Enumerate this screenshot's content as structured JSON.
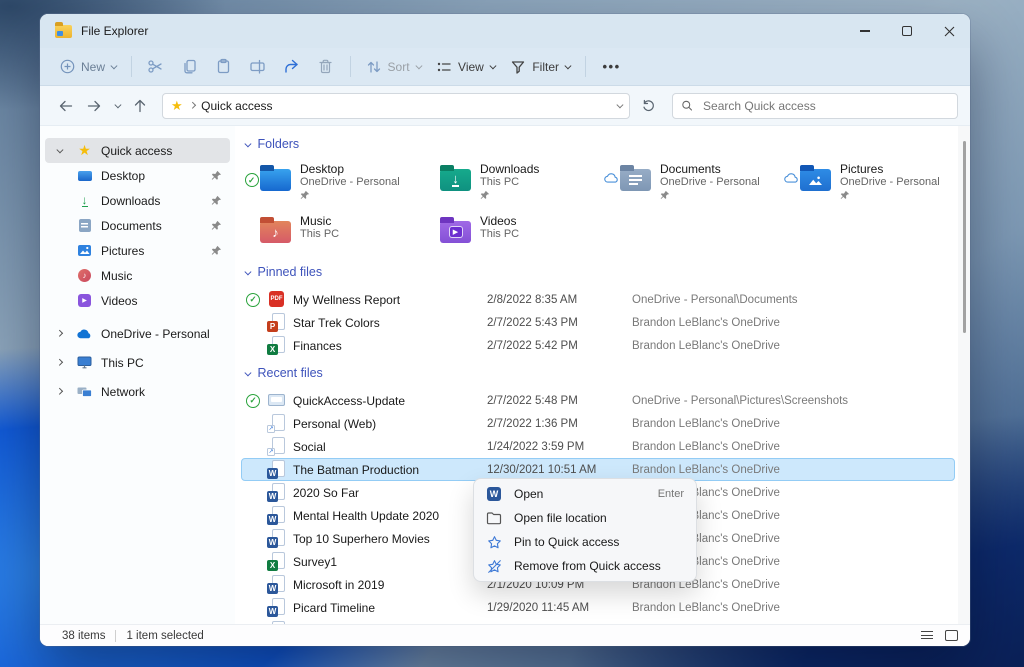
{
  "window": {
    "title": "File Explorer"
  },
  "toolbar": {
    "new": "New",
    "sort": "Sort",
    "view": "View",
    "filter": "Filter",
    "more": "•••",
    "icons": [
      "plus-circle-icon",
      "cut-icon",
      "copy-icon",
      "paste-icon",
      "rename-icon",
      "share-icon",
      "delete-icon",
      "sort-icon",
      "view-icon",
      "filter-icon",
      "more-icon"
    ]
  },
  "navbar": {
    "breadcrumb": "Quick access",
    "search_placeholder": "Search Quick access",
    "icons": [
      "back-arrow-icon",
      "forward-arrow-icon",
      "history-chevron-icon",
      "up-arrow-icon",
      "star-icon",
      "refresh-icon",
      "search-icon"
    ]
  },
  "sidebar": {
    "items": [
      {
        "label": "Quick access",
        "icon": "star-icon",
        "selected": true,
        "expanded": true
      },
      {
        "label": "Desktop",
        "icon": "desktop-icon",
        "pinned": true
      },
      {
        "label": "Downloads",
        "icon": "downloads-icon",
        "pinned": true
      },
      {
        "label": "Documents",
        "icon": "documents-icon",
        "pinned": true
      },
      {
        "label": "Pictures",
        "icon": "pictures-icon",
        "pinned": true
      },
      {
        "label": "Music",
        "icon": "music-icon"
      },
      {
        "label": "Videos",
        "icon": "videos-icon"
      },
      {
        "label": "OneDrive - Personal",
        "icon": "onedrive-cloud-icon",
        "expandable": true
      },
      {
        "label": "This PC",
        "icon": "monitor-icon",
        "expandable": true
      },
      {
        "label": "Network",
        "icon": "network-icon",
        "expandable": true
      }
    ]
  },
  "folders": {
    "title": "Folders",
    "tiles": [
      {
        "name": "Desktop",
        "location": "OneDrive - Personal",
        "icon": "desktop-folder-icon",
        "badge": "synced-badge",
        "pinned": true
      },
      {
        "name": "Downloads",
        "location": "This PC",
        "icon": "downloads-folder-icon",
        "badge": "",
        "pinned": true
      },
      {
        "name": "Documents",
        "location": "OneDrive - Personal",
        "icon": "documents-folder-icon",
        "badge": "cloud-badge",
        "pinned": true
      },
      {
        "name": "Pictures",
        "location": "OneDrive - Personal",
        "icon": "pictures-folder-icon",
        "badge": "cloud-badge",
        "pinned": true
      },
      {
        "name": "Music",
        "location": "This PC",
        "icon": "music-folder-icon",
        "badge": "",
        "pinned": false
      },
      {
        "name": "Videos",
        "location": "This PC",
        "icon": "videos-folder-icon",
        "badge": "",
        "pinned": false
      }
    ]
  },
  "pinned_files": {
    "title": "Pinned files",
    "rows": [
      {
        "name": "My Wellness Report",
        "date": "2/8/2022 8:35 AM",
        "location": "OneDrive - Personal\\Documents",
        "icon": "pdf-file-icon",
        "badge": "synced-badge"
      },
      {
        "name": "Star Trek Colors",
        "date": "2/7/2022 5:43 PM",
        "location": "Brandon LeBlanc's OneDrive",
        "icon": "powerpoint-file-icon",
        "badge": ""
      },
      {
        "name": "Finances",
        "date": "2/7/2022 5:42 PM",
        "location": "Brandon LeBlanc's OneDrive",
        "icon": "excel-file-icon",
        "badge": ""
      }
    ]
  },
  "recent_files": {
    "title": "Recent files",
    "rows": [
      {
        "name": "QuickAccess-Update",
        "date": "2/7/2022 5:48 PM",
        "location": "OneDrive - Personal\\Pictures\\Screenshots",
        "icon": "image-file-icon",
        "badge": "synced-badge"
      },
      {
        "name": "Personal (Web)",
        "date": "2/7/2022 1:36 PM",
        "location": "Brandon LeBlanc's OneDrive",
        "icon": "generic-file-icon",
        "badge": ""
      },
      {
        "name": "Social",
        "date": "1/24/2022 3:59 PM",
        "location": "Brandon LeBlanc's OneDrive",
        "icon": "generic-file-icon",
        "badge": ""
      },
      {
        "name": "The Batman Production",
        "date": "12/30/2021 10:51 AM",
        "location": "Brandon LeBlanc's OneDrive",
        "icon": "word-file-icon",
        "badge": "",
        "selected": true
      },
      {
        "name": "2020 So Far",
        "date": "",
        "location": "Brandon LeBlanc's OneDrive",
        "icon": "word-file-icon",
        "badge": ""
      },
      {
        "name": "Mental Health Update 2020",
        "date": "",
        "location": "Brandon LeBlanc's OneDrive",
        "icon": "word-file-icon",
        "badge": ""
      },
      {
        "name": "Top 10 Superhero Movies",
        "date": "",
        "location": "Brandon LeBlanc's OneDrive",
        "icon": "word-file-icon",
        "badge": ""
      },
      {
        "name": "Survey1",
        "date": "",
        "location": "Brandon LeBlanc's OneDrive",
        "icon": "excel-file-icon",
        "badge": ""
      },
      {
        "name": "Microsoft in 2019",
        "date": "2/1/2020 10:09 PM",
        "location": "Brandon LeBlanc's OneDrive",
        "icon": "word-file-icon",
        "badge": ""
      },
      {
        "name": "Picard Timeline",
        "date": "1/29/2020 11:45 AM",
        "location": "Brandon LeBlanc's OneDrive",
        "icon": "word-file-icon",
        "badge": ""
      }
    ]
  },
  "context_menu": {
    "items": [
      {
        "label": "Open",
        "shortcut": "Enter",
        "icon": "word-icon"
      },
      {
        "label": "Open file location",
        "shortcut": "",
        "icon": "folder-outline-icon"
      },
      {
        "label": "Pin to Quick access",
        "shortcut": "",
        "icon": "star-outline-icon"
      },
      {
        "label": "Remove from Quick access",
        "shortcut": "",
        "icon": "star-slash-icon"
      }
    ]
  },
  "status_bar": {
    "count": "38 items",
    "selected": "1 item selected"
  }
}
